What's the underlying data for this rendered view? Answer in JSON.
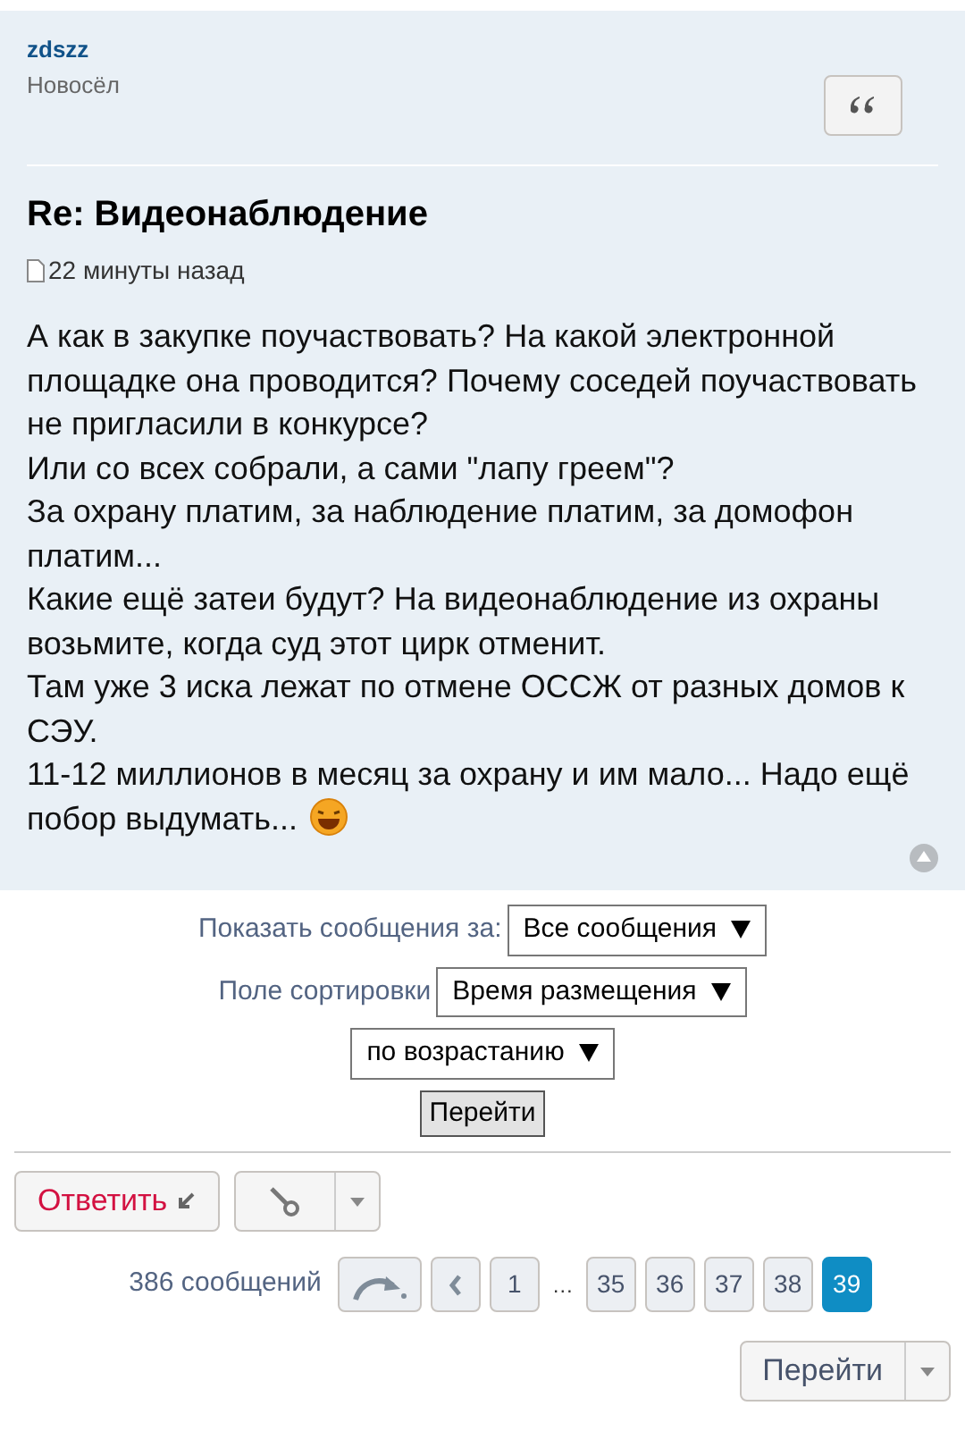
{
  "post": {
    "author": "zdszz",
    "rank": "Новосёл",
    "title": "Re: Видеонаблюдение",
    "time": "22 минуты назад",
    "paragraphs": [
      "А как в закупке поучаствовать? На какой электронной площадке она проводится? Почему соседей поучаствовать не пригласили в конкурсе?",
      "Или со всех собрали, а сами \"лапу греем\"?",
      "За охрану платим, за наблюдение платим, за домофон платим...",
      "Какие ещё затеи будут? На видеонаблюдение из охраны возьмите, когда суд этот цирк отменит.",
      "Там уже 3 иска лежат по отмене ОССЖ от разных домов к СЭУ.",
      "11-12 миллионов в месяц за охрану и им мало... Надо ещё побор выдумать..."
    ]
  },
  "filters": [
    {
      "label": "Показать сообщения за:",
      "value": "Все сообщения"
    },
    {
      "label": "Поле сортировки",
      "value": "Время размещения"
    },
    {
      "value": "по возрастанию"
    }
  ],
  "go_button": "Перейти",
  "reply_button": "Ответить",
  "post_count": "386 сообщений",
  "pages": [
    {
      "label": "1",
      "selected": false
    },
    {
      "label": "…",
      "kind": "gap"
    },
    {
      "label": "35",
      "selected": false
    },
    {
      "label": "36",
      "selected": false
    },
    {
      "label": "37",
      "selected": false
    },
    {
      "label": "38",
      "selected": false
    },
    {
      "label": "39",
      "selected": true
    }
  ],
  "jump_button": "Перейти"
}
